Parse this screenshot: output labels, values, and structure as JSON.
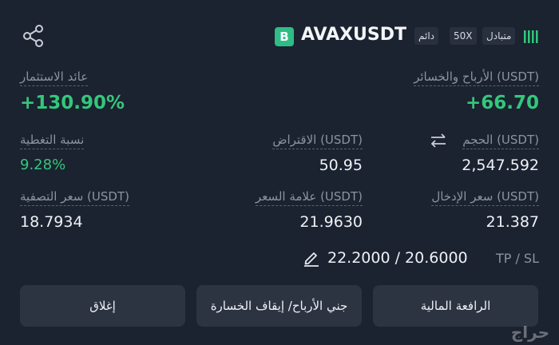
{
  "header": {
    "pair": "AVAXUSDT",
    "coin_badge": "B",
    "tag_mode": "دائم",
    "tag_leverage": "50X",
    "tag_margin": "متبادل",
    "bars_icon": "signal-bars-icon"
  },
  "stats": {
    "pnl_label": "الأرباح والخسائر (USDT)",
    "pnl_value": "+66.70",
    "roi_label": "عائد الاستثمار",
    "roi_value": "+130.90%",
    "size_label": "الحجم (USDT)",
    "size_value": "2,547.592",
    "borrow_label": "الاقتراض (USDT)",
    "borrow_value": "50.95",
    "coverage_label": "نسبة التغطية",
    "coverage_value": "9.28%",
    "entry_label": "سعر الإدخال (USDT)",
    "entry_value": "21.387",
    "mark_label": "علامة السعر (USDT)",
    "mark_value": "21.9630",
    "liq_label": "سعر التصفية (USDT)",
    "liq_value": "18.7934"
  },
  "tpsl": {
    "label": "TP / SL",
    "value": "22.2000 / 20.6000"
  },
  "buttons": {
    "leverage": "الرافعة المالية",
    "tpsl": "جني الأرباح/ إيقاف الخسارة",
    "close": "إغلاق"
  },
  "watermark": "حراج",
  "colors": {
    "background": "#1b2230",
    "positive": "#34c77b",
    "badge": "#2ebd85",
    "button": "#2c3442"
  }
}
